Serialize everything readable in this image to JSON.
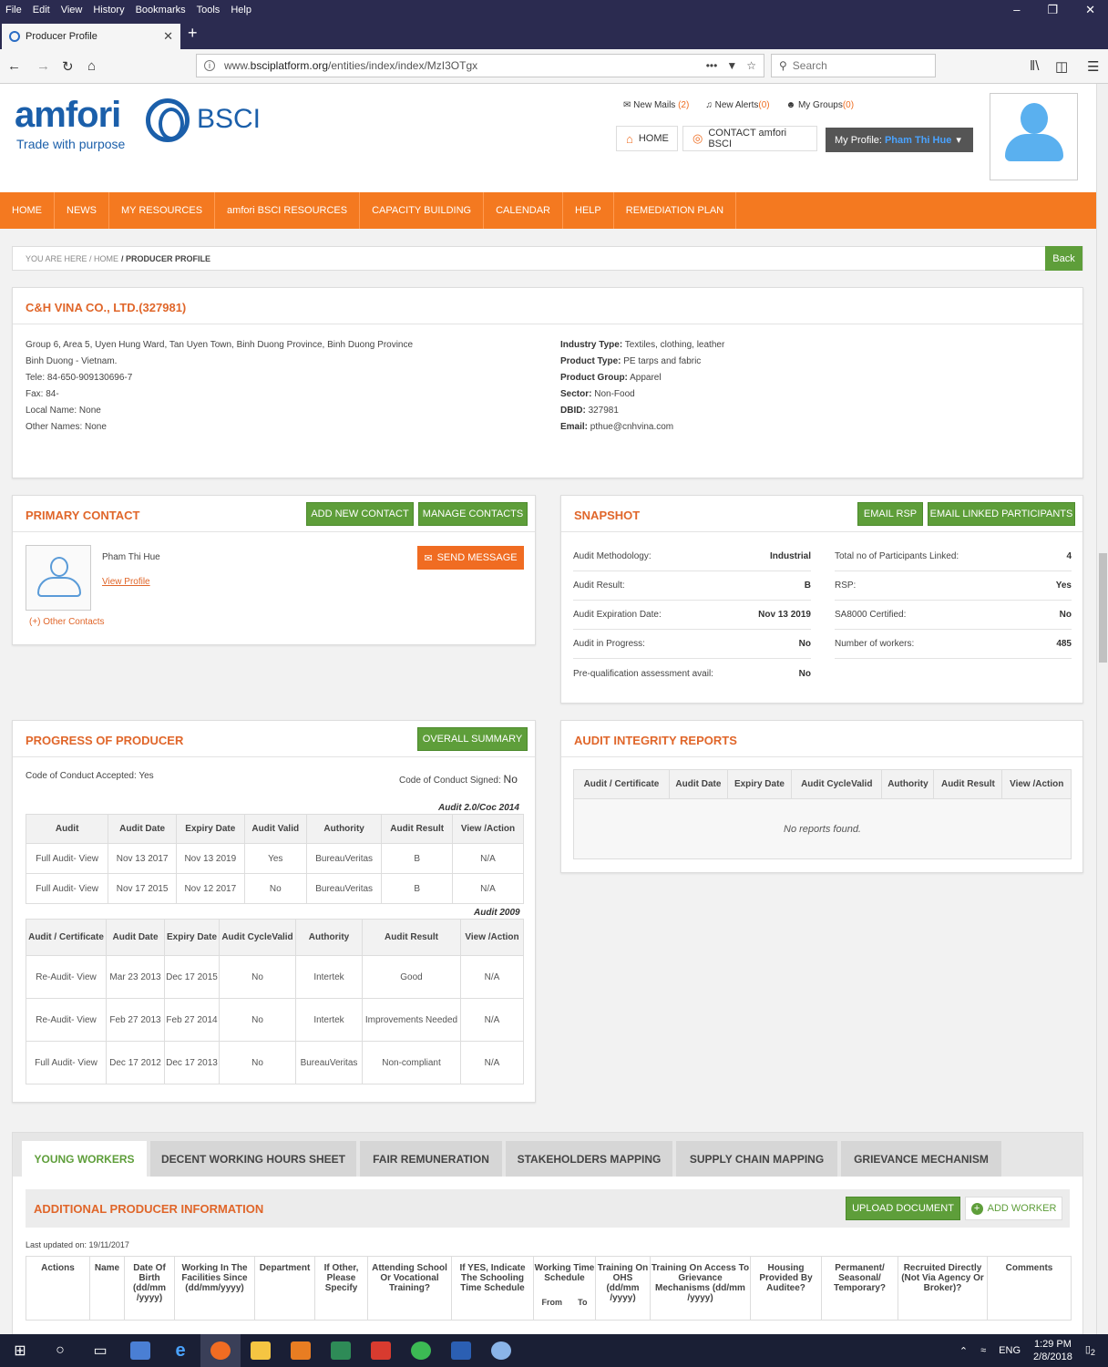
{
  "browser": {
    "menu": [
      "File",
      "Edit",
      "View",
      "History",
      "Bookmarks",
      "Tools",
      "Help"
    ],
    "tab_title": "Producer Profile",
    "url_prefix": "www.",
    "url_domain": "bsciplatform.org",
    "url_path": "/entities/index/index/MzI3OTgx",
    "search_placeholder": "Search"
  },
  "header": {
    "logo_word": "amfori",
    "logo_bsci": "BSCI",
    "tagline": "Trade with purpose",
    "new_mails_label": "New Mails",
    "new_mails_count": "(2)",
    "new_alerts_label": "New Alerts",
    "new_alerts_count": "(0)",
    "my_groups_label": "My Groups",
    "my_groups_count": "(0)",
    "home_btn": "HOME",
    "contact_btn": "CONTACT amfori BSCI",
    "profile_label": "My Profile:",
    "profile_name": "Pham Thi Hue"
  },
  "nav": [
    "HOME",
    "NEWS",
    "MY RESOURCES",
    "amfori BSCI RESOURCES",
    "CAPACITY BUILDING",
    "CALENDAR",
    "HELP",
    "REMEDIATION PLAN"
  ],
  "breadcrumb": {
    "prefix": "YOU ARE HERE / HOME",
    "current": "/ PRODUCER PROFILE",
    "back": "Back"
  },
  "company": {
    "name": "C&H VINA CO., LTD.(327981)",
    "address1": "Group 6, Area 5, Uyen Hung Ward, Tan Uyen Town, Binh Duong Province, Binh Duong Province",
    "address2": "Binh Duong - Vietnam.",
    "tele": "Tele: 84-650-909130696-7",
    "fax": "Fax: 84-",
    "local_name": "Local Name: None",
    "other_names": "Other Names: None",
    "industry_label": "Industry Type:",
    "industry": "Textiles, clothing, leather",
    "product_type_label": "Product Type:",
    "product_type": "PE tarps and fabric",
    "product_group_label": "Product Group:",
    "product_group": "Apparel",
    "sector_label": "Sector:",
    "sector": "Non-Food",
    "dbid_label": "DBID:",
    "dbid": "327981",
    "email_label": "Email:",
    "email": "pthue@cnhvina.com"
  },
  "primary_contact": {
    "title": "PRIMARY CONTACT",
    "add_btn": "ADD NEW CONTACT",
    "manage_btn": "MANAGE CONTACTS",
    "name": "Pham Thi Hue",
    "view_profile": "View Profile",
    "send_message": "SEND MESSAGE",
    "other_contacts": "(+) Other Contacts"
  },
  "snapshot": {
    "title": "SNAPSHOT",
    "email_rsp": "EMAIL RSP",
    "email_linked": "EMAIL LINKED PARTICIPANTS",
    "left": [
      {
        "label": "Audit Methodology:",
        "value": "Industrial"
      },
      {
        "label": "Audit Result:",
        "value": "B"
      },
      {
        "label": "Audit Expiration Date:",
        "value": "Nov 13 2019"
      },
      {
        "label": "Audit in Progress:",
        "value": "No"
      },
      {
        "label": "Pre-qualification assessment avail:",
        "value": "No"
      }
    ],
    "right": [
      {
        "label": "Total no of Participants Linked:",
        "value": "4"
      },
      {
        "label": "RSP:",
        "value": "Yes"
      },
      {
        "label": "SA8000 Certified:",
        "value": "No"
      },
      {
        "label": "Number of workers:",
        "value": "485"
      }
    ]
  },
  "progress": {
    "title": "PROGRESS OF PRODUCER",
    "overall_btn": "OVERALL SUMMARY",
    "coc_accepted": "Code of Conduct Accepted: Yes",
    "coc_signed_label": "Code of Conduct Signed:",
    "coc_signed_value": "No",
    "audit2_label": "Audit 2.0/Coc 2014",
    "audit2_headers": [
      "Audit",
      "Audit Date",
      "Expiry Date",
      "Audit Valid",
      "Authority",
      "Audit Result",
      "View /Action"
    ],
    "audit2_rows": [
      [
        "Full Audit- View",
        "Nov 13 2017",
        "Nov 13 2019",
        "Yes",
        "BureauVeritas",
        "B",
        "N/A"
      ],
      [
        "Full Audit- View",
        "Nov 17 2015",
        "Nov 12 2017",
        "No",
        "BureauVeritas",
        "B",
        "N/A"
      ]
    ],
    "audit2009_label": "Audit 2009",
    "audit2009_headers": [
      "Audit / Certificate",
      "Audit Date",
      "Expiry Date",
      "Audit CycleValid",
      "Authority",
      "Audit Result",
      "View /Action"
    ],
    "audit2009_rows": [
      [
        "Re-Audit- View",
        "Mar 23 2013",
        "Dec 17 2015",
        "No",
        "Intertek",
        "Good",
        "N/A"
      ],
      [
        "Re-Audit- View",
        "Feb 27 2013",
        "Feb 27 2014",
        "No",
        "Intertek",
        "Improvements Needed",
        "N/A"
      ],
      [
        "Full Audit- View",
        "Dec 17 2012",
        "Dec 17 2013",
        "No",
        "BureauVeritas",
        "Non-compliant",
        "N/A"
      ]
    ]
  },
  "integrity": {
    "title": "AUDIT INTEGRITY REPORTS",
    "headers": [
      "Audit / Certificate",
      "Audit Date",
      "Expiry Date",
      "Audit CycleValid",
      "Authority",
      "Audit Result",
      "View /Action"
    ],
    "empty": "No reports found."
  },
  "bottom_tabs": [
    "YOUNG WORKERS",
    "DECENT WORKING HOURS SHEET",
    "FAIR REMUNERATION",
    "STAKEHOLDERS MAPPING",
    "SUPPLY CHAIN MAPPING",
    "GRIEVANCE MECHANISM"
  ],
  "additional": {
    "title": "ADDITIONAL PRODUCER INFORMATION",
    "upload_btn": "UPLOAD DOCUMENT",
    "add_worker_btn": "ADD WORKER",
    "last_updated": "Last updated on: 19/11/2017",
    "headers": [
      "Actions",
      "Name",
      "Date Of Birth (dd/mm /yyyy)",
      "Working In The Facilities Since (dd/mm/yyyy)",
      "Department",
      "If Other, Please Specify",
      "Attending School Or Vocational Training?",
      "If YES, Indicate The Schooling Time Schedule",
      "Working Time Schedule",
      "Training On OHS (dd/mm /yyyy)",
      "Training On Access To Grievance Mechanisms (dd/mm /yyyy)",
      "Housing Provided By Auditee?",
      "Permanent/ Seasonal/ Temporary?",
      "Recruited Directly (Not Via Agency Or Broker)?",
      "Comments"
    ],
    "sub_from": "From",
    "sub_to": "To"
  },
  "taskbar": {
    "lang": "ENG",
    "time": "1:29 PM",
    "date": "2/8/2018",
    "notif_count": "2"
  }
}
